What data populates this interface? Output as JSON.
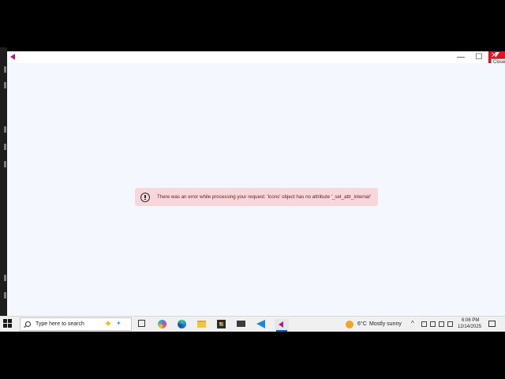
{
  "window": {
    "close_tooltip": "Close",
    "minimize_glyph": "—",
    "maximize_glyph": "☐",
    "close_glyph": "✕"
  },
  "error": {
    "message": "There was an error while processing your request: 'Icons' object has no attribute '_set_attr_internal'"
  },
  "taskbar": {
    "search_placeholder": "Type here to search",
    "weather_temp": "6°C",
    "weather_desc": "Mostly sunny",
    "tray_chevron": "^",
    "clock_time": "6:06 PM",
    "clock_date": "12/14/2025",
    "icons": [
      "windows-start-icon",
      "search-icon",
      "task-view-icon",
      "copilot-icon",
      "edge-icon",
      "file-explorer-icon",
      "store-icon",
      "mail-icon",
      "vscode-icon",
      "app-icon",
      "weather-icon",
      "notification-icon"
    ]
  },
  "colors": {
    "close_red": "#e81123",
    "error_bg": "#f8d7da",
    "app_bg": "#f4f8fe",
    "accent": "#0067c0"
  }
}
